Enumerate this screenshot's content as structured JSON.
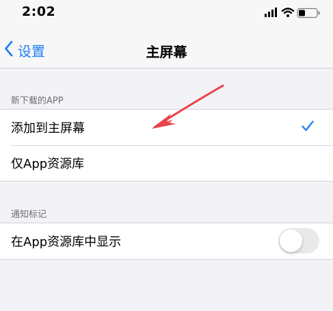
{
  "status_bar": {
    "time": "2:02"
  },
  "nav": {
    "back_label": "设置",
    "title": "主屏幕"
  },
  "sections": [
    {
      "header": "新下载的APP",
      "rows": [
        {
          "label": "添加到主屏幕",
          "checked": true
        },
        {
          "label": "仅App资源库",
          "checked": false
        }
      ]
    },
    {
      "header": "通知标记",
      "rows": [
        {
          "label": "在App资源库中显示",
          "toggle_on": false
        }
      ]
    }
  ],
  "colors": {
    "accent": "#1f7ff1",
    "annotation": "#e8434a",
    "background": "#f2f2f7"
  }
}
